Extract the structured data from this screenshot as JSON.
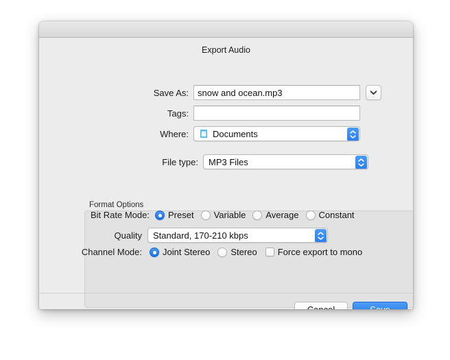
{
  "dialog": {
    "title": "Export Audio"
  },
  "fields": {
    "save_as": {
      "label": "Save As:",
      "value": "snow and  ocean.mp3",
      "placeholder": "",
      "expand_icon": "chevron-down-icon"
    },
    "tags": {
      "label": "Tags:",
      "value": "",
      "placeholder": ""
    },
    "where": {
      "label": "Where:",
      "value": "Documents",
      "icon": "documents-folder-icon",
      "stepper_icon": "chevron-up-down-icon"
    },
    "file_type": {
      "label": "File type:",
      "value": "MP3 Files",
      "stepper_icon": "chevron-up-down-icon"
    }
  },
  "format_options": {
    "group_label": "Format Options",
    "bit_rate_mode": {
      "label": "Bit Rate Mode:",
      "options": [
        {
          "label": "Preset",
          "selected": true
        },
        {
          "label": "Variable",
          "selected": false
        },
        {
          "label": "Average",
          "selected": false
        },
        {
          "label": "Constant",
          "selected": false
        }
      ]
    },
    "quality": {
      "label": "Quality",
      "value": "Standard, 170-210 kbps",
      "stepper_icon": "chevron-up-down-icon"
    },
    "channel_mode": {
      "label": "Channel Mode:",
      "options": [
        {
          "label": "Joint Stereo",
          "selected": true
        },
        {
          "label": "Stereo",
          "selected": false
        }
      ],
      "force_mono": {
        "label": "Force export to mono",
        "checked": false
      }
    }
  },
  "help": {
    "icon": "help-question-icon",
    "label": "?"
  },
  "buttons": {
    "cancel": "Cancel",
    "save": "Save"
  },
  "colors": {
    "accent": "#2b7def",
    "window_bg": "#ececec",
    "group_bg": "#e2e2e2"
  }
}
